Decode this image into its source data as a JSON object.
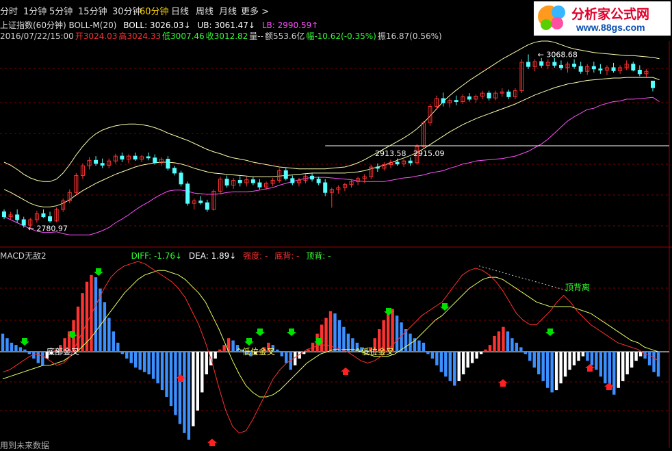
{
  "periods": [
    "分时",
    "1分钟",
    "5分钟",
    "15分钟",
    "30分钟",
    "60分钟",
    "日线",
    "周线",
    "月线",
    "更多 >"
  ],
  "active_period": "60分钟",
  "logo": {
    "title": "分析家公式网",
    "url": "www.88gs.com"
  },
  "boll": {
    "name": "上证指数(60分钟) BOLL-M(20)",
    "boll_label": "BOLL: 3026.03↓",
    "ub_label": "UB: 3061.47↓",
    "lb_label": "LB: 2990.59↑"
  },
  "bar_info": {
    "datetime": "2016/07/22/15:00",
    "open": "开3024.03",
    "high": "高3024.33",
    "low": "低3007.46",
    "close": "收3012.82",
    "volume": "量--",
    "amount": "额553.6亿",
    "change": "幅-10.62(-0.35%)",
    "amplitude": "振16.87(0.56%)"
  },
  "annotations": {
    "max_label": "3068.68",
    "min_label": "2780.97",
    "mid_label_1": "2913.58",
    "mid_label_2": "2915.09"
  },
  "macd": {
    "name": "MACD无敌2",
    "diff_label": "DIFF: -1.76↓",
    "dea_label": "DEA: 1.89↓",
    "strength_label": "强度: -",
    "bottom_div_label": "底背: -",
    "top_div_label": "顶背: -",
    "cross1": "底部金叉",
    "cross2": "低位金叉",
    "cross3": "低位金叉",
    "top_div_text": "顶背离"
  },
  "footer_note": "用到未来数据",
  "colors": {
    "up": "#ff3232",
    "down": "#54ffff",
    "hist_down": "#3b8fff",
    "white": "#ffffff",
    "mid": "#ffffb0",
    "upper": "#ffffb0",
    "lower": "#ff50ff",
    "diff": "#ff3030",
    "dea": "#e8ff60"
  },
  "chart_data": [
    {
      "type": "candlestick",
      "title": "上证指数(60分钟)",
      "ylim": [
        2760,
        3090
      ],
      "candles": [
        [
          2808,
          2812,
          2796,
          2800
        ],
        [
          2800,
          2808,
          2795,
          2803
        ],
        [
          2803,
          2812,
          2790,
          2795
        ],
        [
          2795,
          2800,
          2782,
          2786
        ],
        [
          2786,
          2798,
          2781,
          2795
        ],
        [
          2795,
          2810,
          2790,
          2805
        ],
        [
          2805,
          2812,
          2798,
          2800
        ],
        [
          2800,
          2808,
          2790,
          2793
        ],
        [
          2793,
          2815,
          2791,
          2812
        ],
        [
          2812,
          2830,
          2808,
          2826
        ],
        [
          2826,
          2845,
          2822,
          2840
        ],
        [
          2840,
          2872,
          2836,
          2868
        ],
        [
          2868,
          2888,
          2862,
          2884
        ],
        [
          2884,
          2898,
          2878,
          2893
        ],
        [
          2893,
          2900,
          2884,
          2888
        ],
        [
          2888,
          2896,
          2880,
          2885
        ],
        [
          2885,
          2896,
          2880,
          2892
        ],
        [
          2892,
          2904,
          2888,
          2900
        ],
        [
          2900,
          2906,
          2890,
          2895
        ],
        [
          2895,
          2903,
          2888,
          2900
        ],
        [
          2900,
          2906,
          2892,
          2895
        ],
        [
          2895,
          2902,
          2890,
          2899
        ],
        [
          2899,
          2906,
          2893,
          2897
        ],
        [
          2897,
          2903,
          2886,
          2889
        ],
        [
          2889,
          2898,
          2884,
          2895
        ],
        [
          2895,
          2900,
          2876,
          2880
        ],
        [
          2880,
          2884,
          2868,
          2872
        ],
        [
          2872,
          2876,
          2850,
          2854
        ],
        [
          2854,
          2858,
          2818,
          2822
        ],
        [
          2822,
          2830,
          2812,
          2826
        ],
        [
          2826,
          2834,
          2820,
          2823
        ],
        [
          2823,
          2828,
          2808,
          2812
        ],
        [
          2812,
          2845,
          2810,
          2842
        ],
        [
          2842,
          2866,
          2838,
          2862
        ],
        [
          2862,
          2868,
          2848,
          2852
        ],
        [
          2852,
          2864,
          2846,
          2860
        ],
        [
          2860,
          2867,
          2850,
          2856
        ],
        [
          2856,
          2866,
          2850,
          2861
        ],
        [
          2861,
          2866,
          2852,
          2856
        ],
        [
          2856,
          2862,
          2845,
          2849
        ],
        [
          2849,
          2858,
          2844,
          2855
        ],
        [
          2855,
          2864,
          2850,
          2860
        ],
        [
          2860,
          2880,
          2856,
          2876
        ],
        [
          2876,
          2880,
          2860,
          2863
        ],
        [
          2863,
          2868,
          2852,
          2856
        ],
        [
          2856,
          2864,
          2850,
          2860
        ],
        [
          2860,
          2870,
          2855,
          2867
        ],
        [
          2867,
          2872,
          2858,
          2862
        ],
        [
          2862,
          2866,
          2852,
          2856
        ],
        [
          2856,
          2862,
          2834,
          2840
        ],
        [
          2840,
          2848,
          2815,
          2845
        ],
        [
          2845,
          2852,
          2838,
          2848
        ],
        [
          2848,
          2856,
          2842,
          2853
        ],
        [
          2853,
          2862,
          2848,
          2858
        ],
        [
          2858,
          2866,
          2852,
          2863
        ],
        [
          2863,
          2870,
          2856,
          2866
        ],
        [
          2866,
          2886,
          2862,
          2882
        ],
        [
          2882,
          2888,
          2874,
          2880
        ],
        [
          2880,
          2890,
          2876,
          2886
        ],
        [
          2886,
          2894,
          2880,
          2890
        ],
        [
          2890,
          2896,
          2884,
          2887
        ],
        [
          2887,
          2895,
          2882,
          2892
        ],
        [
          2892,
          2898,
          2884,
          2889
        ],
        [
          2889,
          2920,
          2886,
          2916
        ],
        [
          2916,
          2958,
          2912,
          2955
        ],
        [
          2955,
          2986,
          2950,
          2982
        ],
        [
          2982,
          3000,
          2976,
          2995
        ],
        [
          2995,
          3005,
          2982,
          2988
        ],
        [
          2988,
          2996,
          2980,
          2992
        ],
        [
          2992,
          3000,
          2984,
          2990
        ],
        [
          2990,
          3002,
          2986,
          2998
        ],
        [
          2998,
          3004,
          2990,
          2994
        ],
        [
          2994,
          3002,
          2988,
          2999
        ],
        [
          2999,
          3008,
          2994,
          3004
        ],
        [
          3004,
          3008,
          2992,
          2996
        ],
        [
          2996,
          3008,
          2992,
          3004
        ],
        [
          3004,
          3012,
          2998,
          3006
        ],
        [
          3006,
          3010,
          2994,
          2998
        ],
        [
          2998,
          3012,
          2994,
          3008
        ],
        [
          3008,
          3060,
          3004,
          3055
        ],
        [
          3055,
          3068,
          3044,
          3048
        ],
        [
          3048,
          3060,
          3040,
          3056
        ],
        [
          3056,
          3062,
          3046,
          3050
        ],
        [
          3050,
          3060,
          3044,
          3055
        ],
        [
          3055,
          3062,
          3046,
          3050
        ],
        [
          3050,
          3058,
          3042,
          3046
        ],
        [
          3046,
          3056,
          3038,
          3052
        ],
        [
          3052,
          3060,
          3044,
          3048
        ],
        [
          3048,
          3056,
          3036,
          3040
        ],
        [
          3040,
          3052,
          3034,
          3048
        ],
        [
          3048,
          3056,
          3038,
          3044
        ],
        [
          3044,
          3052,
          3036,
          3042
        ],
        [
          3042,
          3050,
          3034,
          3046
        ],
        [
          3046,
          3054,
          3038,
          3041
        ],
        [
          3041,
          3050,
          3036,
          3046
        ],
        [
          3046,
          3058,
          3042,
          3052
        ],
        [
          3052,
          3056,
          3040,
          3042
        ],
        [
          3042,
          3050,
          3032,
          3036
        ],
        [
          3036,
          3044,
          3030,
          3040
        ],
        [
          3024,
          3024,
          3007,
          3013
        ]
      ],
      "boll_mid": [
        2845,
        2840,
        2834,
        2828,
        2822,
        2818,
        2816,
        2816,
        2818,
        2822,
        2828,
        2836,
        2843,
        2849,
        2855,
        2860,
        2865,
        2870,
        2874,
        2878,
        2882,
        2885,
        2887,
        2889,
        2890,
        2890,
        2889,
        2887,
        2884,
        2880,
        2877,
        2874,
        2872,
        2871,
        2870,
        2869,
        2868,
        2867,
        2866,
        2866,
        2866,
        2866,
        2867,
        2868,
        2869,
        2870,
        2871,
        2872,
        2872,
        2872,
        2872,
        2872,
        2872,
        2873,
        2874,
        2876,
        2879,
        2882,
        2885,
        2889,
        2893,
        2897,
        2901,
        2906,
        2912,
        2919,
        2926,
        2933,
        2940,
        2946,
        2952,
        2957,
        2962,
        2966,
        2970,
        2974,
        2978,
        2982,
        2986,
        2991,
        2996,
        3001,
        3005,
        3009,
        3013,
        3016,
        3019,
        3021,
        3023,
        3025,
        3026,
        3027,
        3028,
        3029,
        3029,
        3030,
        3030,
        3030,
        3030,
        3030,
        3026
      ],
      "boll_upper": [
        2890,
        2885,
        2878,
        2870,
        2864,
        2860,
        2858,
        2858,
        2862,
        2872,
        2886,
        2902,
        2916,
        2928,
        2937,
        2943,
        2947,
        2950,
        2952,
        2953,
        2953,
        2952,
        2950,
        2947,
        2943,
        2938,
        2934,
        2930,
        2926,
        2921,
        2916,
        2911,
        2907,
        2904,
        2900,
        2897,
        2895,
        2893,
        2890,
        2888,
        2886,
        2884,
        2882,
        2881,
        2880,
        2879,
        2879,
        2879,
        2879,
        2879,
        2880,
        2881,
        2882,
        2885,
        2889,
        2894,
        2900,
        2906,
        2912,
        2918,
        2924,
        2930,
        2937,
        2945,
        2955,
        2966,
        2978,
        2990,
        3000,
        3009,
        3017,
        3025,
        3032,
        3039,
        3046,
        3053,
        3060,
        3066,
        3072,
        3078,
        3084,
        3088,
        3090,
        3090,
        3088,
        3084,
        3080,
        3077,
        3075,
        3073,
        3071,
        3070,
        3069,
        3068,
        3067,
        3066,
        3066,
        3065,
        3064,
        3063,
        3061
      ],
      "boll_lower": [
        2800,
        2795,
        2790,
        2785,
        2780,
        2776,
        2774,
        2774,
        2775,
        2772,
        2770,
        2770,
        2770,
        2770,
        2773,
        2777,
        2782,
        2790,
        2796,
        2803,
        2811,
        2818,
        2824,
        2831,
        2837,
        2842,
        2844,
        2844,
        2842,
        2839,
        2838,
        2837,
        2837,
        2838,
        2840,
        2841,
        2841,
        2841,
        2842,
        2844,
        2846,
        2848,
        2852,
        2855,
        2858,
        2861,
        2863,
        2865,
        2865,
        2865,
        2864,
        2863,
        2862,
        2861,
        2859,
        2858,
        2858,
        2858,
        2858,
        2860,
        2862,
        2864,
        2865,
        2867,
        2869,
        2872,
        2874,
        2876,
        2880,
        2883,
        2887,
        2889,
        2892,
        2893,
        2894,
        2895,
        2896,
        2898,
        2900,
        2904,
        2908,
        2914,
        2920,
        2928,
        2938,
        2948,
        2958,
        2965,
        2971,
        2977,
        2979,
        2984,
        2987,
        2990,
        2991,
        2994,
        2994,
        2995,
        2996,
        2997,
        2990
      ]
    },
    {
      "type": "bar",
      "title": "MACD无敌2",
      "ylim": [
        -40,
        40
      ],
      "histogram": [
        8,
        6,
        4,
        3,
        2,
        1,
        -1,
        -3,
        -5,
        -6,
        -3,
        -1,
        1,
        3,
        6,
        9,
        14,
        20,
        26,
        31,
        34,
        33,
        28,
        22,
        15,
        9,
        4,
        -1,
        -3,
        -5,
        -7,
        -8,
        -9,
        -10,
        -12,
        -14,
        -17,
        -20,
        -24,
        -28,
        -32,
        -36,
        -39,
        -33,
        -26,
        -18,
        -10,
        -6,
        -3,
        1,
        3,
        6,
        5,
        3,
        1,
        -1,
        -2,
        -1,
        0,
        2,
        4,
        3,
        1,
        -2,
        -5,
        -8,
        -6,
        -3,
        -1,
        1,
        4,
        8,
        12,
        15,
        18,
        17,
        14,
        11,
        8,
        6,
        4,
        2,
        1,
        2,
        6,
        10,
        14,
        17,
        19,
        16,
        13,
        10,
        8,
        6,
        5,
        4,
        -1,
        -3,
        -6,
        -9,
        -11,
        -13,
        -15,
        -13,
        -10,
        -7,
        -5,
        -3,
        -1,
        1,
        3,
        7,
        9,
        11,
        9,
        6,
        4,
        2,
        -1,
        -4,
        -7,
        -10,
        -13,
        -16,
        -18,
        -17,
        -14,
        -11,
        -8,
        -6,
        -4,
        -2,
        -4,
        -6,
        -8,
        -11,
        -14,
        -17,
        -19,
        -16,
        -13,
        -10,
        -7,
        -4,
        -2,
        -3,
        -6,
        -9,
        -11
      ],
      "diff": [
        -9,
        -8,
        -6,
        -4,
        -2,
        -1,
        -2,
        -4,
        -6,
        -5,
        -2,
        4,
        10,
        16,
        22,
        28,
        33,
        36,
        38,
        39,
        40,
        39,
        37,
        35,
        33,
        31,
        28,
        24,
        18,
        12,
        4,
        -5,
        -16,
        -26,
        -33,
        -36,
        -35,
        -30,
        -24,
        -18,
        -12,
        -8,
        -5,
        -3,
        -1,
        1,
        2,
        3,
        3,
        2,
        1,
        0,
        -2,
        -4,
        -5,
        -4,
        -2,
        1,
        4,
        7,
        10,
        13,
        16,
        18,
        20,
        22,
        26,
        30,
        34,
        36,
        37,
        36,
        34,
        31,
        27,
        22,
        17,
        14,
        12,
        12,
        15,
        18,
        22,
        25,
        22,
        18,
        15,
        12,
        10,
        8,
        6,
        4,
        3,
        2,
        1,
        -1,
        -2,
        -4
      ],
      "dea": [
        -12,
        -11,
        -10,
        -9,
        -8,
        -7,
        -6,
        -6,
        -5,
        -4,
        -2,
        0,
        3,
        6,
        10,
        14,
        18,
        22,
        26,
        29,
        32,
        34,
        35,
        36,
        36,
        35,
        34,
        32,
        29,
        26,
        22,
        16,
        10,
        3,
        -4,
        -10,
        -15,
        -18,
        -20,
        -20,
        -19,
        -17,
        -14,
        -11,
        -8,
        -5,
        -3,
        -1,
        0,
        1,
        1,
        1,
        1,
        0,
        -1,
        -2,
        -2,
        -2,
        -1,
        1,
        3,
        5,
        8,
        11,
        14,
        16,
        19,
        22,
        25,
        28,
        30,
        32,
        33,
        33,
        32,
        30,
        28,
        26,
        24,
        22,
        21,
        20,
        20,
        20,
        20,
        19,
        18,
        17,
        15,
        13,
        11,
        9,
        7,
        5,
        4,
        2,
        1,
        0
      ]
    }
  ]
}
